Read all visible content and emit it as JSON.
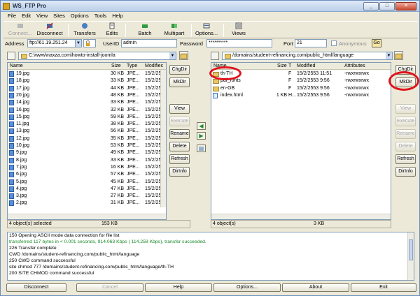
{
  "window": {
    "title": "WS_FTP Pro",
    "controls": [
      "_",
      "□",
      "✕"
    ]
  },
  "menu": [
    "File",
    "Edit",
    "View",
    "Sites",
    "Options",
    "Tools",
    "Help"
  ],
  "toolbar": {
    "connect": "Connect...",
    "disconnect": "Disconnect",
    "transfers": "Transfers",
    "edits": "Edits",
    "batch": "Batch",
    "multipart": "Multipart",
    "options": "Options...",
    "views": "Views"
  },
  "connection": {
    "address_label": "Address",
    "address_value": "ftp://61.19.251.24",
    "userid_label": "UserID",
    "userid_value": "admin",
    "password_label": "Password",
    "password_value": "**********",
    "port_label": "Port",
    "port_value": "21",
    "anonymous_label": "Anonymous",
    "go_label": "Go"
  },
  "local": {
    "path": "C:\\www\\naxza.com\\howto-install-joomla",
    "headers": [
      "Name",
      "Size",
      "Type",
      "Modifiec"
    ],
    "rows": [
      {
        "name": "19.jpg",
        "size": "30 KB",
        "type": "JPE...",
        "mod": "15/2/25"
      },
      {
        "name": "18.jpg",
        "size": "33 KB",
        "type": "JPE...",
        "mod": "15/2/25"
      },
      {
        "name": "17.jpg",
        "size": "44 KB",
        "type": "JPE...",
        "mod": "15/2/25"
      },
      {
        "name": "20.jpg",
        "size": "48 KB",
        "type": "JPE...",
        "mod": "15/2/25"
      },
      {
        "name": "14.jpg",
        "size": "33 KB",
        "type": "JPE...",
        "mod": "15/2/25"
      },
      {
        "name": "16.jpg",
        "size": "32 KB",
        "type": "JPE...",
        "mod": "15/2/25"
      },
      {
        "name": "15.jpg",
        "size": "59 KB",
        "type": "JPE...",
        "mod": "15/2/25"
      },
      {
        "name": "11.jpg",
        "size": "38 KB",
        "type": "JPE...",
        "mod": "15/2/25"
      },
      {
        "name": "13.jpg",
        "size": "56 KB",
        "type": "JPE...",
        "mod": "15/2/25"
      },
      {
        "name": "12.jpg",
        "size": "35 KB",
        "type": "JPE...",
        "mod": "15/2/25"
      },
      {
        "name": "10.jpg",
        "size": "53 KB",
        "type": "JPE...",
        "mod": "15/2/25"
      },
      {
        "name": "9.jpg",
        "size": "49 KB",
        "type": "JPE...",
        "mod": "15/2/25"
      },
      {
        "name": "8.jpg",
        "size": "33 KB",
        "type": "JPE...",
        "mod": "15/2/25"
      },
      {
        "name": "7.jpg",
        "size": "16 KB",
        "type": "JPE...",
        "mod": "15/2/25"
      },
      {
        "name": "6.jpg",
        "size": "57 KB",
        "type": "JPE...",
        "mod": "15/2/25"
      },
      {
        "name": "5.jpg",
        "size": "45 KB",
        "type": "JPE...",
        "mod": "15/2/25"
      },
      {
        "name": "4.jpg",
        "size": "47 KB",
        "type": "JPE...",
        "mod": "15/2/25"
      },
      {
        "name": "3.jpg",
        "size": "27 KB",
        "type": "JPE...",
        "mod": "15/2/25"
      },
      {
        "name": "2.jpg",
        "size": "31 KB",
        "type": "JPE...",
        "mod": "15/2/25"
      }
    ],
    "buttons": [
      "ChgDir",
      "MkDir",
      "View",
      "Execute",
      "Rename",
      "Delete",
      "Refresh",
      "DirInfo"
    ],
    "status_left": "4 object(s) selected",
    "status_right": "153 KB"
  },
  "remote": {
    "path": "/domains/student-refinancing.com/public_html/language",
    "headers": [
      "Name",
      "Size",
      "T",
      "Modified",
      "Attributes"
    ],
    "rows": [
      {
        "name": "th-TH",
        "size": "",
        "t": "F",
        "mod": "15/2/2553 11:51",
        "attr": "-rwxrwxrwx",
        "kind": "folder"
      },
      {
        "name": "pdf_fonts",
        "size": "",
        "t": "F",
        "mod": "15/2/2553 9:56",
        "attr": "-rwxrwxrwx",
        "kind": "folder"
      },
      {
        "name": "en-GB",
        "size": "",
        "t": "F",
        "mod": "15/2/2553 9:56",
        "attr": "-rwxrwxrwx",
        "kind": "folder"
      },
      {
        "name": "index.html",
        "size": "1 KB",
        "t": "H...",
        "mod": "15/2/2553 9:56",
        "attr": "-rwxrwxrwx",
        "kind": "html"
      }
    ],
    "buttons": [
      "ChgDir",
      "MkDir",
      "View",
      "Execute",
      "Rename",
      "Delete",
      "Refresh",
      "DirInfo"
    ],
    "status_left": "4 object(s)",
    "status_right": "3 KB"
  },
  "log": [
    {
      "text": "150 Opening ASCII mode data connection for file list",
      "green": false
    },
    {
      "text": "transferred 117 bytes in < 0.001 seconds, 914.063 Kbps ( 114.258 Kbps), transfer succeeded.",
      "green": true
    },
    {
      "text": "226 Transfer complete",
      "green": false
    },
    {
      "text": "CWD /domains/student-refinancing.com/public_html/language",
      "green": false
    },
    {
      "text": "250 CWD command successful",
      "green": false
    },
    {
      "text": "site chmod 777 /domains/student-refinancing.com/public_html/language/th-TH",
      "green": false
    },
    {
      "text": "200 SITE CHMOD command successful",
      "green": false
    }
  ],
  "bottom": {
    "disconnect": "Disconnect",
    "cancel": "Cancel",
    "help": "Help",
    "options": "Options...",
    "about": "About",
    "exit": "Exit"
  },
  "colors": {
    "highlight_circle": "#e0131c",
    "log_green": "#1a8a2a"
  }
}
